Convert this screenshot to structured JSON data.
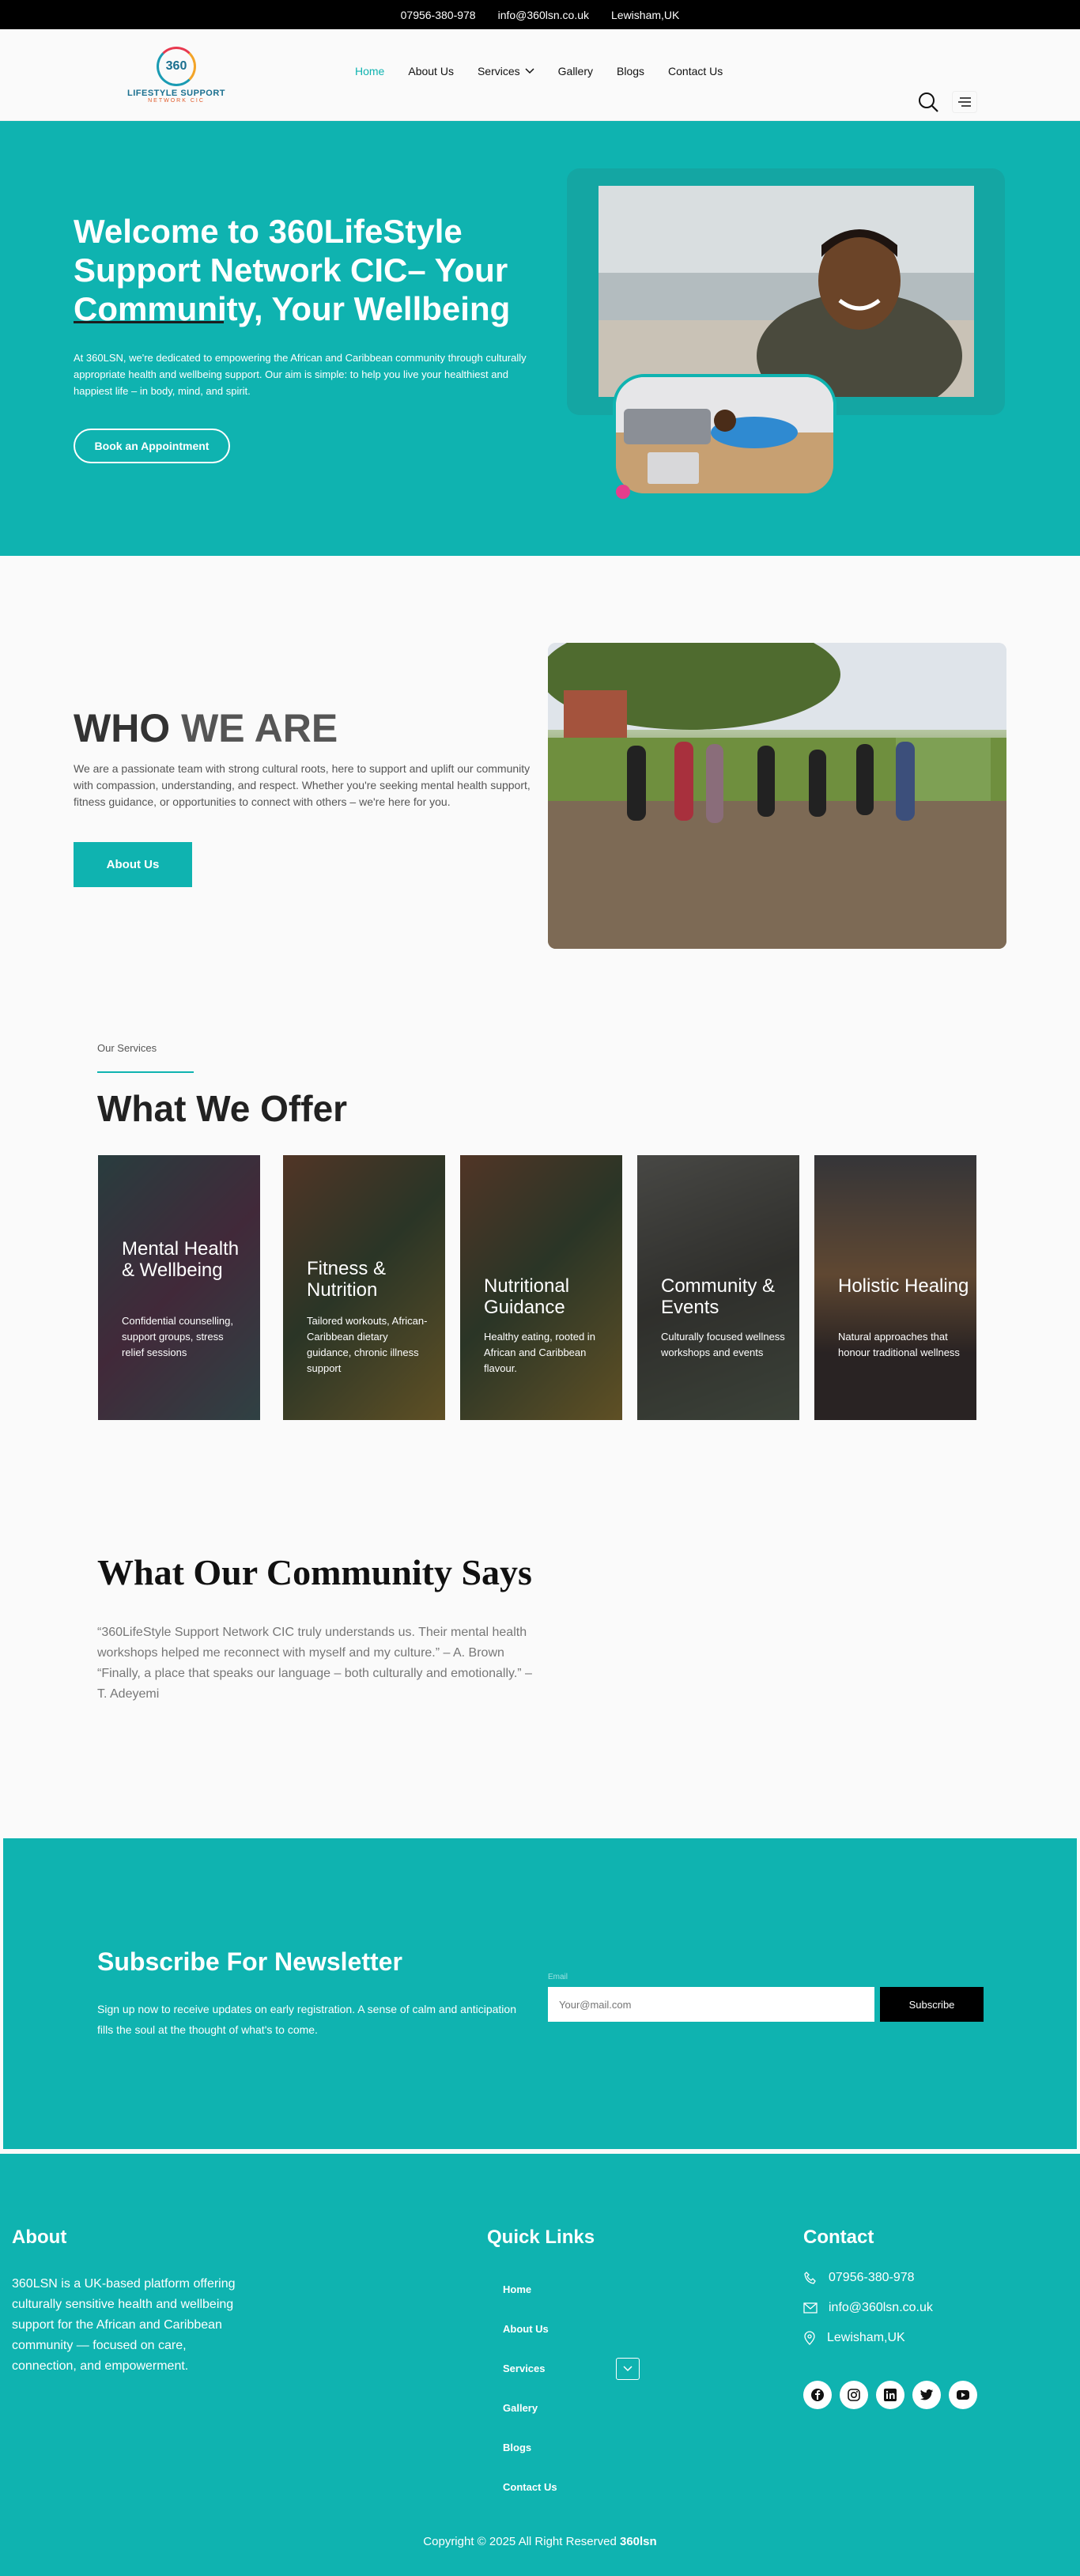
{
  "topbar": {
    "phone": "07956-380-978",
    "email": "info@360lsn.co.uk",
    "location": "Lewisham,UK"
  },
  "logo": {
    "mark": "360",
    "name": "LIFESTYLE SUPPORT",
    "sub": "NETWORK CIC"
  },
  "nav": {
    "home": "Home",
    "about": "About Us",
    "services": "Services",
    "gallery": "Gallery",
    "blogs": "Blogs",
    "contact": "Contact Us"
  },
  "hero": {
    "title": "Welcome to 360LifeStyle Support Network CIC– Your Community, Your Wellbeing",
    "description": "At 360LSN, we're dedicated to empowering the African and Caribbean community through culturally appropriate health and wellbeing support. Our aim is simple: to help you live your healthiest and happiest life – in body, mind, and spirit.",
    "button": "Book an Appointment"
  },
  "who": {
    "title_a": "WHO ",
    "title_b": "WE ARE",
    "description": "We are a passionate team with strong cultural roots, here to support and uplift our community with compassion, understanding, and respect. Whether you're seeking mental health support, fitness guidance, or opportunities to connect with others – we're here for you.",
    "button": "About Us"
  },
  "services": {
    "label": "Our Services",
    "title": "What We Offer",
    "cards": [
      {
        "title": "Mental Health & Wellbeing",
        "text": "Confidential counselling, support groups, stress relief sessions"
      },
      {
        "title": "Fitness & Nutrition",
        "text": " Tailored workouts, African-Caribbean dietary guidance, chronic illness support"
      },
      {
        "title": "Nutritional Guidance",
        "text": "Healthy eating, rooted in African and Caribbean flavour."
      },
      {
        "title": "Community & Events",
        "text": "Culturally focused wellness workshops and events"
      },
      {
        "title": "Holistic Healing",
        "text": "Natural approaches that honour traditional wellness"
      }
    ]
  },
  "testimonials": {
    "title": "What Our Community Says",
    "quote1": "“360LifeStyle Support Network CIC truly understands us. Their mental health workshops helped me reconnect with myself and my culture.” – A. Brown",
    "quote2": "“Finally, a place that speaks our language – both culturally and emotionally.” – T. Adeyemi"
  },
  "newsletter": {
    "title": "Subscribe For Newsletter",
    "description": "Sign up now to receive updates on early registration. A sense of calm and anticipation fills the soul at the thought of what's to come.",
    "label": "Email",
    "placeholder": "Your@mail.com",
    "button": "Subscribe"
  },
  "footer": {
    "about_title": "About",
    "about_text": "360LSN is a UK-based platform offering culturally sensitive health and wellbeing support for the African and Caribbean community — focused on care, connection, and empowerment.",
    "links_title": "Quick Links",
    "links": [
      "Home",
      "About Us",
      "Services",
      "Gallery",
      "Blogs",
      "Contact Us"
    ],
    "contact_title": "Contact",
    "phone": "07956-380-978",
    "email": "info@360lsn.co.uk",
    "location": "Lewisham,UK",
    "copyright": "Copyright © 2025 All Right Reserved ",
    "brand": "360lsn"
  },
  "colors": {
    "accent": "#0fb3b0",
    "dark": "#000000"
  }
}
